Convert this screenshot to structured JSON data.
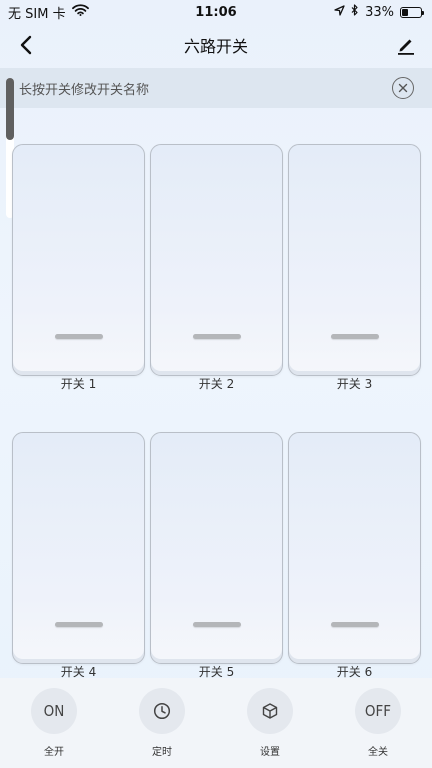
{
  "status_bar": {
    "carrier": "无 SIM 卡",
    "time": "11:06",
    "battery_text": "33%",
    "battery_level": 0.33
  },
  "nav": {
    "title": "六路开关"
  },
  "hint": {
    "text": "长按开关修改开关名称"
  },
  "switches": [
    {
      "label": "开关 1"
    },
    {
      "label": "开关 2"
    },
    {
      "label": "开关 3"
    },
    {
      "label": "开关 4"
    },
    {
      "label": "开关 5"
    },
    {
      "label": "开关 6"
    }
  ],
  "toolbar": {
    "items": [
      {
        "icon_text": "ON",
        "label": "全开"
      },
      {
        "icon": "clock-icon",
        "label": "定时"
      },
      {
        "icon": "cube-icon",
        "label": "设置"
      },
      {
        "icon_text": "OFF",
        "label": "全关"
      }
    ]
  }
}
